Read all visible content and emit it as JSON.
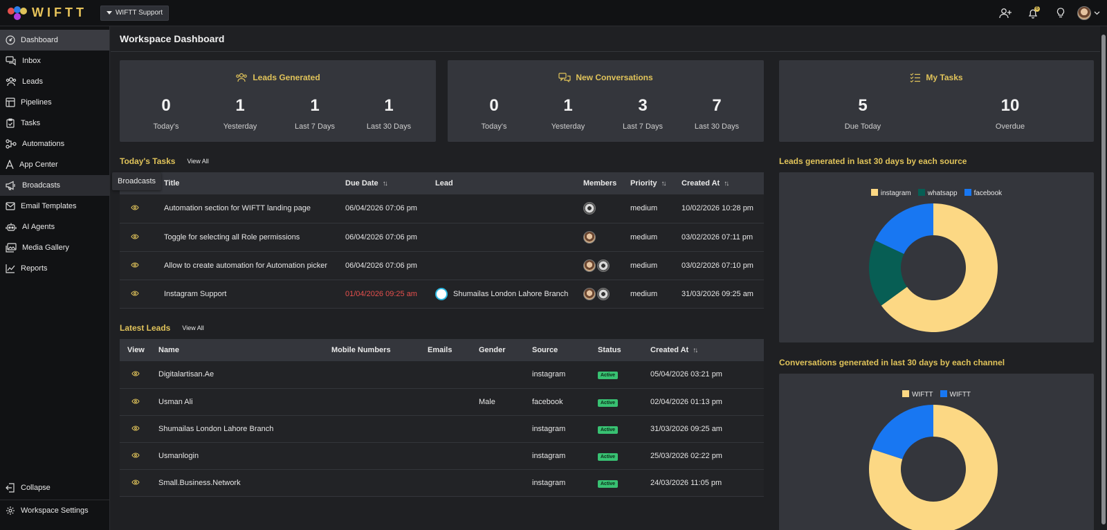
{
  "app": {
    "logo_text": "WIFTT",
    "workspace": "WIFTT Support"
  },
  "topbar": {
    "notification_count": "6"
  },
  "sidebar": {
    "items": [
      {
        "label": "Dashboard",
        "icon": "dashboard-icon"
      },
      {
        "label": "Inbox",
        "icon": "inbox-icon"
      },
      {
        "label": "Leads",
        "icon": "users-icon"
      },
      {
        "label": "Pipelines",
        "icon": "pipeline-icon"
      },
      {
        "label": "Tasks",
        "icon": "clipboard-icon"
      },
      {
        "label": "Automations",
        "icon": "automation-icon"
      },
      {
        "label": "App Center",
        "icon": "app-center-icon"
      },
      {
        "label": "Broadcasts",
        "icon": "megaphone-icon"
      },
      {
        "label": "Email Templates",
        "icon": "mail-icon"
      },
      {
        "label": "AI Agents",
        "icon": "robot-icon"
      },
      {
        "label": "Media Gallery",
        "icon": "gallery-icon"
      },
      {
        "label": "Reports",
        "icon": "chart-line-icon"
      }
    ],
    "collapse": "Collapse",
    "workspace_settings": "Workspace Settings",
    "tooltip": "Broadcasts"
  },
  "page": {
    "title": "Workspace Dashboard"
  },
  "cards": {
    "leads": {
      "title": "Leads Generated",
      "stats": [
        {
          "value": "0",
          "label": "Today's"
        },
        {
          "value": "1",
          "label": "Yesterday"
        },
        {
          "value": "1",
          "label": "Last 7 Days"
        },
        {
          "value": "1",
          "label": "Last 30 Days"
        }
      ]
    },
    "conversations": {
      "title": "New Conversations",
      "stats": [
        {
          "value": "0",
          "label": "Today's"
        },
        {
          "value": "1",
          "label": "Yesterday"
        },
        {
          "value": "3",
          "label": "Last 7 Days"
        },
        {
          "value": "7",
          "label": "Last 30 Days"
        }
      ]
    },
    "tasks": {
      "title": "My Tasks",
      "stats": [
        {
          "value": "5",
          "label": "Due Today"
        },
        {
          "value": "10",
          "label": "Overdue"
        }
      ]
    }
  },
  "todays_tasks": {
    "title": "Today's Tasks",
    "view_all": "View All",
    "columns": [
      "Title",
      "Due Date",
      "Lead",
      "Members",
      "Priority",
      "Created At"
    ],
    "rows": [
      {
        "title": "Automation section for WIFTT landing page",
        "due": "06/04/2026 07:06 pm",
        "lead": "",
        "priority": "medium",
        "created": "10/02/2026 10:28 pm"
      },
      {
        "title": "Toggle for selecting all Role permissions",
        "due": "06/04/2026 07:06 pm",
        "lead": "",
        "priority": "medium",
        "created": "03/02/2026 07:11 pm"
      },
      {
        "title": "Allow to create automation for Automation picker",
        "due": "06/04/2026 07:06 pm",
        "lead": "",
        "priority": "medium",
        "created": "03/02/2026 07:10 pm"
      },
      {
        "title": "Instagram Support",
        "due": "01/04/2026 09:25 am",
        "lead": "Shumailas London Lahore Branch",
        "priority": "medium",
        "created": "31/03/2026 09:25 am"
      }
    ]
  },
  "latest_leads": {
    "title": "Latest Leads",
    "view_all": "View All",
    "columns": [
      "View",
      "Name",
      "Mobile Numbers",
      "Emails",
      "Gender",
      "Source",
      "Status",
      "Created At"
    ],
    "rows": [
      {
        "name": "Digitalartisan.Ae",
        "mobile": "",
        "email": "",
        "gender": "",
        "source": "instagram",
        "status": "Active",
        "created": "05/04/2026 03:21 pm"
      },
      {
        "name": "Usman Ali",
        "mobile": "",
        "email": "",
        "gender": "Male",
        "source": "facebook",
        "status": "Active",
        "created": "02/04/2026 01:13 pm"
      },
      {
        "name": "Shumailas London Lahore Branch",
        "mobile": "",
        "email": "",
        "gender": "",
        "source": "instagram",
        "status": "Active",
        "created": "31/03/2026 09:25 am"
      },
      {
        "name": "Usmanlogin",
        "mobile": "",
        "email": "",
        "gender": "",
        "source": "instagram",
        "status": "Active",
        "created": "25/03/2026 02:22 pm"
      },
      {
        "name": "Small.Business.Network",
        "mobile": "",
        "email": "",
        "gender": "",
        "source": "instagram",
        "status": "Active",
        "created": "24/03/2026 11:05 pm"
      }
    ]
  },
  "colors": {
    "accent": "#e0c35a",
    "active_badge": "#38c172",
    "overdue": "#e6504d"
  },
  "chart_data": [
    {
      "type": "pie",
      "title": "Leads generated in last 30 days by each source",
      "legend_position": "top-center",
      "categories": [
        "instagram",
        "whatsapp",
        "facebook"
      ],
      "values": [
        65,
        17,
        18
      ],
      "colors": [
        "#fcd884",
        "#075e54",
        "#1877f2"
      ],
      "donut": true
    },
    {
      "type": "pie",
      "title": "Conversations generated in last 30 days by each channel",
      "legend_position": "top-center",
      "categories": [
        "WIFTT",
        "WIFTT"
      ],
      "values": [
        80,
        20
      ],
      "colors": [
        "#fcd884",
        "#1877f2"
      ],
      "donut": true
    }
  ]
}
